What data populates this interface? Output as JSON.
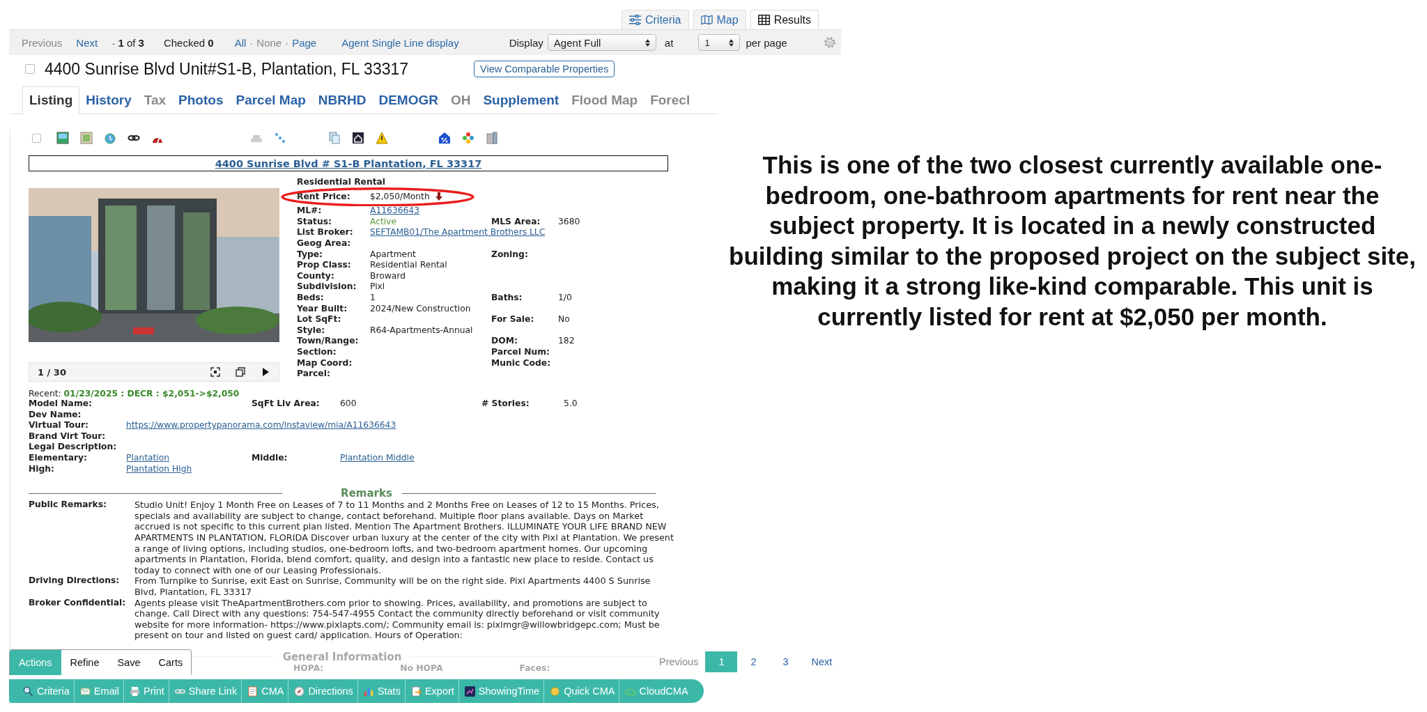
{
  "view_tabs": [
    {
      "label": "Criteria",
      "selected": false
    },
    {
      "label": "Map",
      "selected": false
    },
    {
      "label": "Results",
      "selected": true
    }
  ],
  "toolbar": {
    "previous": "Previous",
    "next": "Next",
    "position": "· **1** of **3**",
    "checked": "Checked **0**",
    "separator": "·",
    "selection_links": [
      {
        "label": "All",
        "disabled": false
      },
      {
        "label": "None",
        "disabled": true
      },
      {
        "label": "Page",
        "disabled": false
      }
    ],
    "single_line": "Agent Single Line display",
    "display_label": "Display",
    "display_value": "Agent Full",
    "at_label": "at",
    "per_page_value": "1",
    "per_page_label": "per page"
  },
  "listing": {
    "checked": false,
    "title": "4400 Sunrise Blvd Unit#S1-B, Plantation, FL 33317",
    "compare_button": "View Comparable Properties"
  },
  "detail_tabs": [
    {
      "label": "Listing",
      "selected": true,
      "disabled": false
    },
    {
      "label": "History",
      "selected": false,
      "disabled": false
    },
    {
      "label": "Tax",
      "selected": false,
      "disabled": true
    },
    {
      "label": "Photos",
      "selected": false,
      "disabled": false
    },
    {
      "label": "Parcel Map",
      "selected": false,
      "disabled": false
    },
    {
      "label": "NBRHD",
      "selected": false,
      "disabled": false
    },
    {
      "label": "DEMOGR",
      "selected": false,
      "disabled": false
    },
    {
      "label": "OH",
      "selected": false,
      "disabled": true
    },
    {
      "label": "Supplement",
      "selected": false,
      "disabled": false
    },
    {
      "label": "Flood Map",
      "selected": false,
      "disabled": true
    },
    {
      "label": "Forecl",
      "selected": false,
      "disabled": true
    }
  ],
  "icon_row": {
    "checked": false
  },
  "address_link": "4400 Sunrise Blvd # S1-B Plantation, FL 33317",
  "photo": {
    "kind": "picture",
    "counter": "1 / 30"
  },
  "property_type": "Residential Rental",
  "price": {
    "label": "Rent Price:",
    "value": "$2,050/Month",
    "decreased": true
  },
  "details": [
    {
      "left": {
        "label": "ML#:",
        "value": "A11636643",
        "kind": "link"
      }
    },
    {
      "left": {
        "label": "Status:",
        "value": "Active",
        "kind": "status"
      },
      "right": {
        "label": "MLS Area:",
        "value": "3680",
        "kind": "plain"
      }
    },
    {
      "left": {
        "label": "List Broker:",
        "value": "SEFTAMB01/The Apartment Brothers LLC",
        "kind": "link"
      }
    },
    {
      "left": {
        "label": "Geog Area:"
      }
    },
    {
      "left": {
        "label": "Type:",
        "value": "Apartment",
        "kind": "plain"
      },
      "right": {
        "label": "Zoning:"
      }
    },
    {
      "left": {
        "label": "Prop Class:",
        "value": "Residential Rental",
        "kind": "plain"
      }
    },
    {
      "left": {
        "label": "County:",
        "value": "Broward",
        "kind": "plain"
      }
    },
    {
      "left": {
        "label": "Subdivision:",
        "value": "Pixl",
        "kind": "plain"
      }
    },
    {
      "left": {
        "label": "Beds:",
        "value": "1",
        "kind": "plain"
      },
      "right": {
        "label": "Baths:",
        "value": "1/0",
        "kind": "plain"
      }
    },
    {
      "left": {
        "label": "Year Built:",
        "value": "2024/New Construction",
        "kind": "plain"
      }
    },
    {
      "left": {
        "label": "Lot SqFt:"
      },
      "right": {
        "label": "For Sale:",
        "value": "No",
        "kind": "plain"
      }
    },
    {
      "left": {
        "label": "Style:",
        "value": "R64-Apartments-Annual",
        "kind": "plain"
      }
    },
    {
      "left": {
        "label": "Town/Range:"
      },
      "right": {
        "label": "DOM:",
        "value": "182",
        "kind": "plain"
      }
    },
    {
      "left": {
        "label": "Section:"
      },
      "right": {
        "label": "Parcel Num:"
      }
    },
    {
      "left": {
        "label": "Map Coord:"
      },
      "right": {
        "label": "Munic Code:"
      }
    },
    {
      "left": {
        "label": "Parcel:"
      }
    }
  ],
  "recent": "Recent: **01/23/2025 : DECR : $2,051->$2,050**",
  "extra_rows": [
    {
      "cells": [
        {
          "label": "Model Name:"
        },
        {
          "label": "SqFt Liv Area:",
          "value": "600",
          "kind": "plain"
        },
        {
          "label": "# Stories:",
          "value": "5.0",
          "kind": "plain"
        }
      ]
    },
    {
      "cells": [
        {
          "label": "Dev Name:"
        }
      ]
    },
    {
      "cells": [
        {
          "label": "Virtual Tour:",
          "value": "https://www.propertypanorama.com/instaview/mia/A11636643",
          "kind": "link"
        }
      ]
    },
    {
      "cells": [
        {
          "label": "Brand Virt Tour:"
        }
      ]
    },
    {
      "cells": [
        {
          "label": "Legal Description:"
        }
      ]
    },
    {
      "cells": [
        {
          "label": "Elementary:",
          "value": "Plantation",
          "kind": "link"
        },
        {
          "label": "Middle:",
          "value": "Plantation Middle",
          "kind": "link"
        }
      ]
    },
    {
      "cells": [
        {
          "label": "High:",
          "value": "Plantation High",
          "kind": "link"
        }
      ]
    }
  ],
  "remarks": {
    "heading": "Remarks",
    "items": [
      {
        "label": "Public Remarks:",
        "text": "Studio Unit! Enjoy 1 Month Free on Leases of 7 to 11 Months and 2 Months Free on Leases of 12 to 15 Months. Prices, specials and availability are subject to change, contact beforehand. Multiple floor plans available. Days on Market accrued is not specific to this current plan listed. Mention The Apartment Brothers. ILLUMINATE YOUR LIFE BRAND NEW APARTMENTS IN PLANTATION, FLORIDA Discover urban luxury at the center of the city with Pixl at Plantation. We present a range of living options, including studios, one-bedroom lofts, and two-bedroom apartment homes. Our upcoming apartments in Plantation, Florida, blend comfort, quality, and design into a fantastic new place to reside. Contact us today to connect with one of our Leasing Professionals."
      },
      {
        "label": "Driving Directions:",
        "text": "From Turnpike to Sunrise, exit East on Sunrise, Community will be on the right side. Pixl Apartments 4400 S Sunrise Blvd, Plantation, FL 33317"
      },
      {
        "label": "Broker Confidential:",
        "text": "Agents please visit TheApartmentBrothers.com prior to showing. Prices, availability, and promotions are subject to change. Call Direct with any questions: 754-547-4955 Contact the community directly beforehand or visit community website for more information- https://www.pixlapts.com/; Community email is: pixlmgr@willowbridgepc.com; Must be present on tour and listed on guest card/ application. Hours of Operation:"
      }
    ]
  },
  "faded": {
    "heading": "General Information",
    "labels": [
      "HOPA:",
      "No HOPA",
      "Faces:"
    ]
  },
  "annotation": "This is one of the two closest currently available one-bedroom, one-bathroom apartments for rent near the subject property. It is located in a newly constructed building similar to the proposed project on the subject site, making it a strong like-kind comparable. This unit is currently listed for rent at $2,050 per month.",
  "action_tabs": [
    {
      "label": "Actions",
      "selected": true
    },
    {
      "label": "Refine",
      "selected": false
    },
    {
      "label": "Save",
      "selected": false
    },
    {
      "label": "Carts",
      "selected": false
    }
  ],
  "actions": [
    "Criteria",
    "Email",
    "Print",
    "Share Link",
    "CMA",
    "Directions",
    "Stats",
    "Export",
    "ShowingTime",
    "Quick CMA",
    "CloudCMA"
  ],
  "pagination": {
    "previous": "Previous",
    "pages": [
      {
        "label": "1",
        "selected": true
      },
      {
        "label": "2",
        "selected": false
      },
      {
        "label": "3",
        "selected": false
      }
    ],
    "next": "Next"
  }
}
